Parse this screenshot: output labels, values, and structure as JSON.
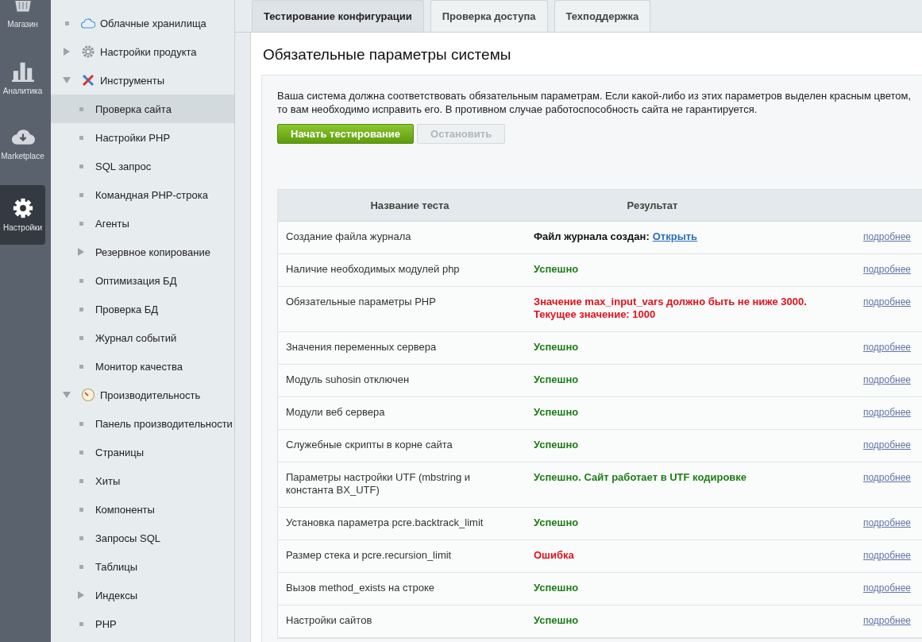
{
  "rail": [
    {
      "label": "Магазин",
      "selected": false
    },
    {
      "label": "Аналитика",
      "selected": false
    },
    {
      "label": "Marketplace",
      "selected": false
    },
    {
      "label": "Настройки",
      "selected": true
    }
  ],
  "nav": [
    {
      "label": "Облачные хранилища",
      "kind": "leaf",
      "selected": false
    },
    {
      "label": "Настройки продукта",
      "kind": "group",
      "expanded": false,
      "selected": false
    },
    {
      "label": "Инструменты",
      "kind": "group",
      "expanded": true,
      "selected": false,
      "children": [
        {
          "label": "Проверка сайта",
          "kind": "leaf",
          "selected": true
        },
        {
          "label": "Настройки PHP",
          "kind": "leaf",
          "selected": false
        },
        {
          "label": "SQL запрос",
          "kind": "leaf",
          "selected": false
        },
        {
          "label": "Командная PHP-строка",
          "kind": "leaf",
          "selected": false
        },
        {
          "label": "Агенты",
          "kind": "leaf",
          "selected": false
        },
        {
          "label": "Резервное копирование",
          "kind": "group",
          "expanded": false,
          "selected": false
        },
        {
          "label": "Оптимизация БД",
          "kind": "leaf",
          "selected": false
        },
        {
          "label": "Проверка БД",
          "kind": "leaf",
          "selected": false
        },
        {
          "label": "Журнал событий",
          "kind": "leaf",
          "selected": false
        },
        {
          "label": "Монитор качества",
          "kind": "leaf",
          "selected": false
        }
      ]
    },
    {
      "label": "Производительность",
      "kind": "group",
      "expanded": true,
      "selected": false,
      "children": [
        {
          "label": "Панель производительности",
          "kind": "leaf",
          "selected": false
        },
        {
          "label": "Страницы",
          "kind": "leaf",
          "selected": false
        },
        {
          "label": "Хиты",
          "kind": "leaf",
          "selected": false
        },
        {
          "label": "Компоненты",
          "kind": "leaf",
          "selected": false
        },
        {
          "label": "Запросы SQL",
          "kind": "leaf",
          "selected": false
        },
        {
          "label": "Таблицы",
          "kind": "leaf",
          "selected": false
        },
        {
          "label": "Индексы",
          "kind": "group",
          "expanded": false,
          "selected": false
        },
        {
          "label": "PHP",
          "kind": "leaf",
          "selected": false
        }
      ]
    }
  ],
  "tabs": [
    {
      "label": "Тестирование конфигурации",
      "selected": true
    },
    {
      "label": "Проверка доступа",
      "selected": false
    },
    {
      "label": "Техподдержка",
      "selected": false
    }
  ],
  "heading": "Обязательные параметры системы",
  "intro": "Ваша система должна соответствовать обязательным параметрам. Если какой-либо из этих параметров выделен красным цветом, то вам необходимо исправить его. В противном случае работоспособность сайта не гарантируется.",
  "buttons": [
    {
      "label": "Начать тестирование",
      "disabled": false
    },
    {
      "label": "Остановить",
      "disabled": true
    }
  ],
  "table": {
    "columns": [
      "Название теста",
      "Результат"
    ],
    "rows": [
      {
        "name": "Создание файла журнала",
        "color": "#111111",
        "result": "Файл журнала создан:",
        "link": "Открыть",
        "details": "подробнее"
      },
      {
        "name": "Наличие необходимых модулей php",
        "color": "#1e7d17",
        "result": "Успешно",
        "details": "подробнее"
      },
      {
        "name": "Обязательные параметры PHP",
        "color": "#e0121b",
        "result": "Значение max_input_vars должно быть не ниже 3000. Текущее значение: 1000",
        "details": "подробнее"
      },
      {
        "name": "Значения переменных сервера",
        "color": "#1e7d17",
        "result": "Успешно",
        "details": "подробнее"
      },
      {
        "name": "Модуль suhosin отключен",
        "color": "#1e7d17",
        "result": "Успешно",
        "details": "подробнее"
      },
      {
        "name": "Модули веб сервера",
        "color": "#1e7d17",
        "result": "Успешно",
        "details": "подробнее"
      },
      {
        "name": "Служебные скрипты в корне сайта",
        "color": "#1e7d17",
        "result": "Успешно",
        "details": "подробнее"
      },
      {
        "name": "Параметры настройки UTF (mbstring и константа BX_UTF)",
        "color": "#1e7d17",
        "result": "Успешно. Сайт работает в UTF кодировке",
        "details": "подробнее"
      },
      {
        "name": "Установка параметра pcre.backtrack_limit",
        "color": "#1e7d17",
        "result": "Успешно",
        "details": "подробнее"
      },
      {
        "name": "Размер стека и pcre.recursion_limit",
        "color": "#e0121b",
        "result": "Ошибка",
        "details": "подробнее"
      },
      {
        "name": "Вызов method_exists на строке",
        "color": "#1e7d17",
        "result": "Успешно",
        "details": "подробнее"
      },
      {
        "name": "Настройки сайтов",
        "color": "#1e7d17",
        "result": "Успешно",
        "details": "подробнее"
      }
    ]
  }
}
